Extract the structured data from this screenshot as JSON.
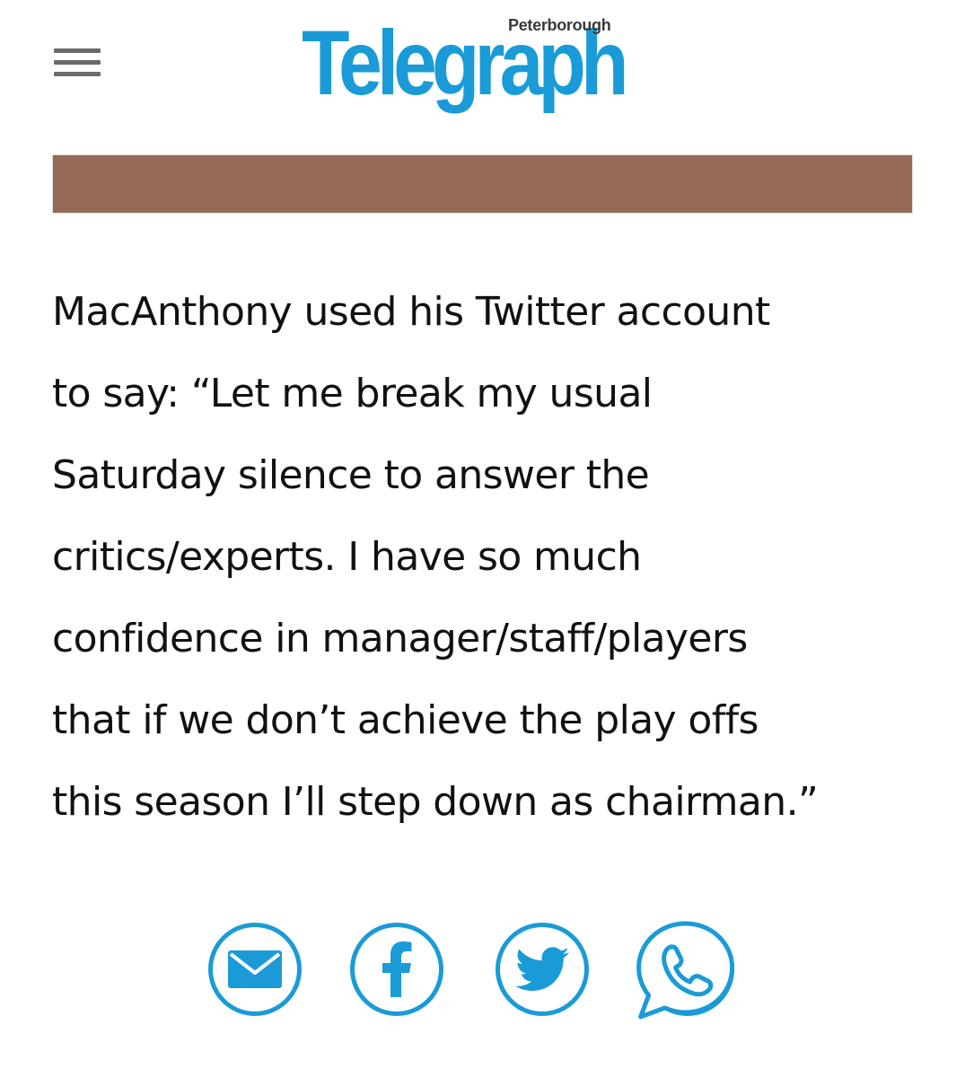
{
  "header": {
    "menu_icon": "hamburger-menu-icon",
    "logo": {
      "name": "Telegraph",
      "region": "Peterborough",
      "color": "#1a9bd7"
    }
  },
  "banner": {
    "color": "#946b59"
  },
  "article": {
    "paragraph_lines": [
      "MacAnthony used his Twitter account",
      "to say: “Let me break my usual",
      "Saturday silence to answer the",
      "critics/experts. I have so much",
      "confidence in manager/staff/players",
      "that if we don’t achieve the play offs",
      "this season I’ll step down as chairman.”"
    ]
  },
  "share": {
    "accent_color": "#1a9bd7",
    "buttons": [
      {
        "icon": "email-icon"
      },
      {
        "icon": "facebook-icon"
      },
      {
        "icon": "twitter-icon"
      },
      {
        "icon": "whatsapp-icon"
      }
    ]
  }
}
